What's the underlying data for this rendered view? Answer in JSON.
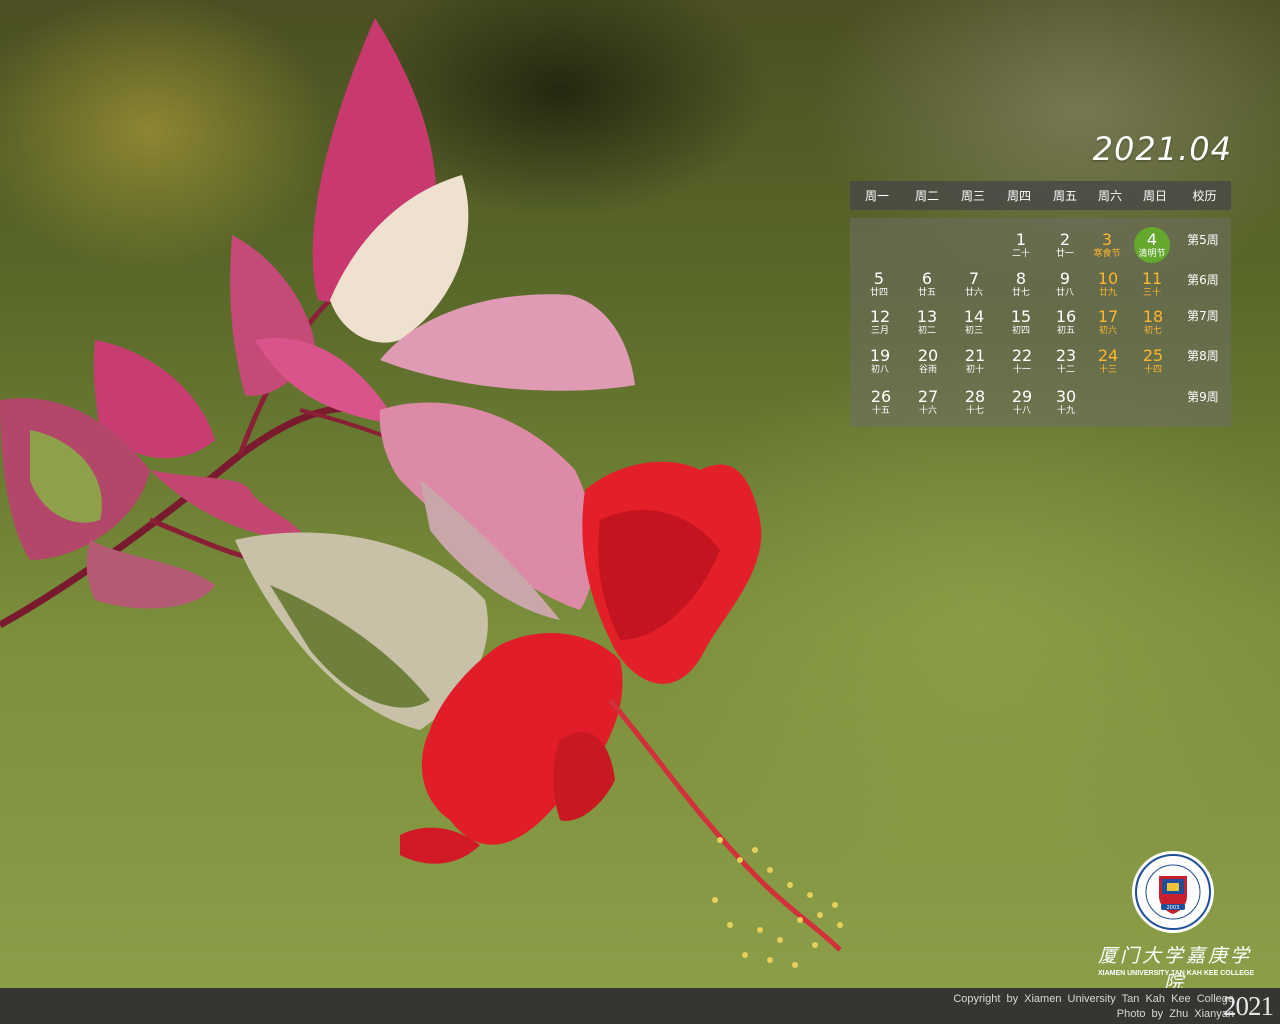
{
  "calendar": {
    "title": "2021.04",
    "headers": [
      "周一",
      "周二",
      "周三",
      "周四",
      "周五",
      "周六",
      "周日",
      "校历"
    ],
    "weeks": [
      "第5周",
      "第6周",
      "第7周",
      "第8周",
      "第9周"
    ],
    "days": [
      {
        "num": "1",
        "lunar": "二十"
      },
      {
        "num": "2",
        "lunar": "廿一"
      },
      {
        "num": "3",
        "lunar": "寒食节"
      },
      {
        "num": "4",
        "lunar": "清明节"
      },
      {
        "num": "5",
        "lunar": "廿四"
      },
      {
        "num": "6",
        "lunar": "廿五"
      },
      {
        "num": "7",
        "lunar": "廿六"
      },
      {
        "num": "8",
        "lunar": "廿七"
      },
      {
        "num": "9",
        "lunar": "廿八"
      },
      {
        "num": "10",
        "lunar": "廿九"
      },
      {
        "num": "11",
        "lunar": "三十"
      },
      {
        "num": "12",
        "lunar": "三月"
      },
      {
        "num": "13",
        "lunar": "初二"
      },
      {
        "num": "14",
        "lunar": "初三"
      },
      {
        "num": "15",
        "lunar": "初四"
      },
      {
        "num": "16",
        "lunar": "初五"
      },
      {
        "num": "17",
        "lunar": "初六"
      },
      {
        "num": "18",
        "lunar": "初七"
      },
      {
        "num": "19",
        "lunar": "初八"
      },
      {
        "num": "20",
        "lunar": "谷雨"
      },
      {
        "num": "21",
        "lunar": "初十"
      },
      {
        "num": "22",
        "lunar": "十一"
      },
      {
        "num": "23",
        "lunar": "十二"
      },
      {
        "num": "24",
        "lunar": "十三"
      },
      {
        "num": "25",
        "lunar": "十四"
      },
      {
        "num": "26",
        "lunar": "十五"
      },
      {
        "num": "27",
        "lunar": "十六"
      },
      {
        "num": "28",
        "lunar": "十七"
      },
      {
        "num": "29",
        "lunar": "十八"
      },
      {
        "num": "30",
        "lunar": "十九"
      }
    ],
    "weekend_color": "#ffb62c",
    "today_color": "#64a92e"
  },
  "branding": {
    "school_name_cn": "厦门大学嘉庚学院",
    "school_name_en": "XIAMEN UNIVERSITY TAN KAH KEE COLLEGE",
    "seal_year": "2003"
  },
  "footer": {
    "copyright": "Copyright by Xiamen University Tan Kah Kee College",
    "photo_credit": "Photo by Zhu Xianyan",
    "year": "2021"
  }
}
